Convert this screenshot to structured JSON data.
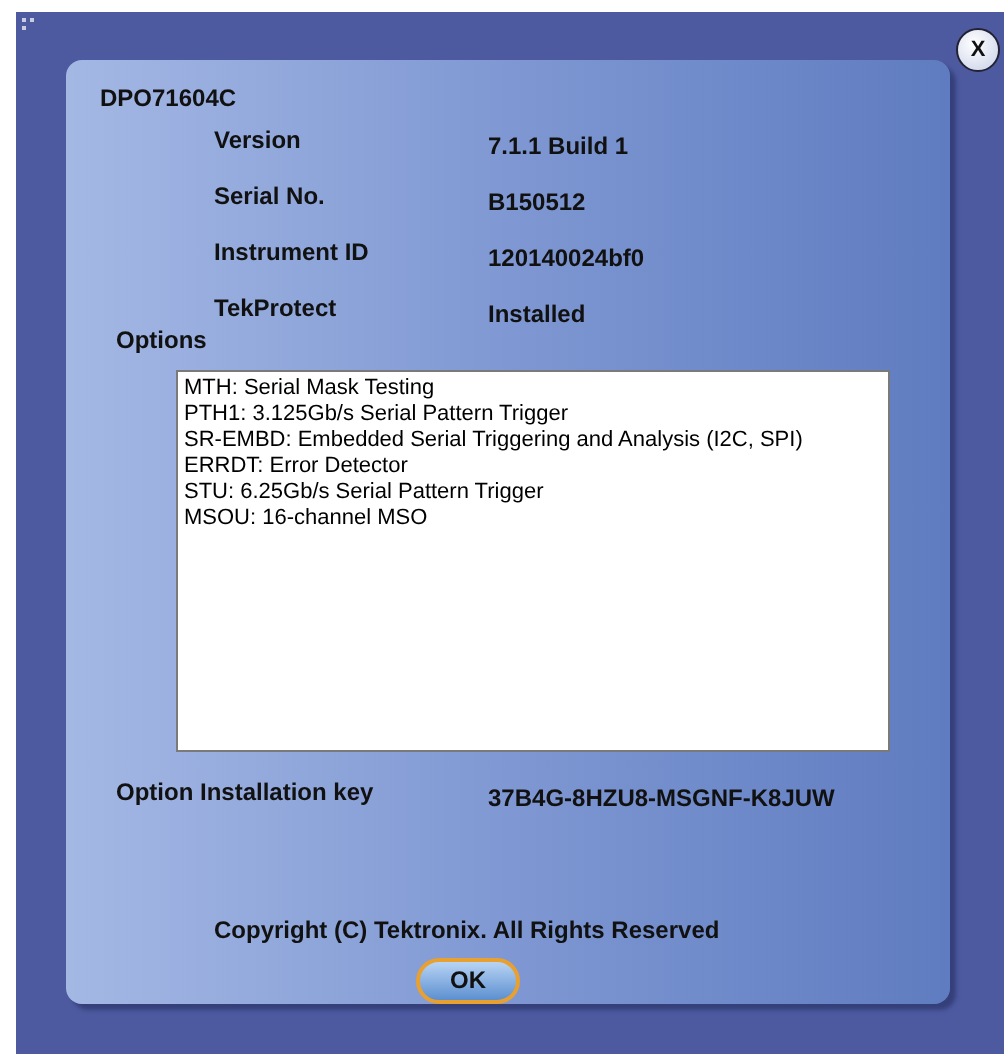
{
  "close_button": {
    "label": "X"
  },
  "model": "DPO71604C",
  "info": [
    {
      "label": "Version",
      "value": "7.1.1 Build 1"
    },
    {
      "label": "Serial No.",
      "value": "B150512"
    },
    {
      "label": "Instrument ID",
      "value": "120140024bf0"
    },
    {
      "label": "TekProtect",
      "value": "Installed"
    }
  ],
  "options": {
    "label": "Options",
    "items": [
      "MTH: Serial Mask Testing",
      "PTH1: 3.125Gb/s Serial Pattern Trigger",
      "SR-EMBD: Embedded Serial Triggering and Analysis (I2C, SPI)",
      "ERRDT: Error Detector",
      "STU: 6.25Gb/s Serial Pattern Trigger",
      "MSOU: 16-channel MSO"
    ]
  },
  "installation_key": {
    "label": "Option Installation key",
    "value": "37B4G-8HZU8-MSGNF-K8JUW"
  },
  "copyright": "Copyright (C) Tektronix.  All Rights Reserved",
  "ok_button": {
    "label": "OK"
  }
}
